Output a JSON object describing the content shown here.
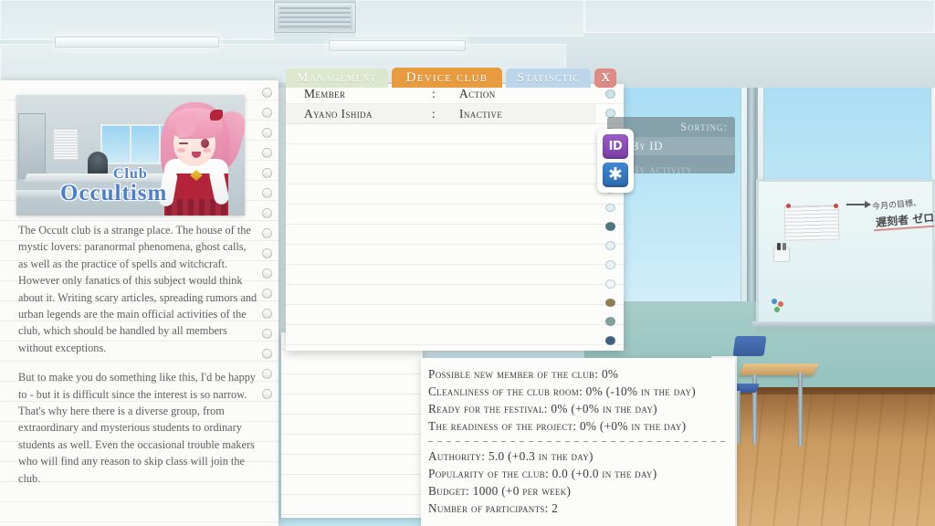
{
  "tabs": [
    {
      "label": "Management",
      "name": "tab-management",
      "state": "inactive"
    },
    {
      "label": "Device club",
      "name": "tab-device-club",
      "state": "active"
    },
    {
      "label": "Statisctic",
      "name": "tab-statistic",
      "state": "inactive"
    }
  ],
  "close_button": {
    "label": "X"
  },
  "member_table": {
    "headers": {
      "member": "Member",
      "separator": ":",
      "action": "Action"
    },
    "rows": [
      {
        "member": "Ayano Ishida",
        "separator": ":",
        "action": "Inactive"
      }
    ]
  },
  "sorting": {
    "title": "Sorting:",
    "options": [
      {
        "label": "By ID",
        "selected": true
      },
      {
        "label": "By activity",
        "selected": false
      }
    ],
    "buttons": [
      {
        "icon": "id-icon",
        "label": "ID",
        "color": "#8a4cb8"
      },
      {
        "icon": "asterisk-icon",
        "label": "✱",
        "color": "#3478c0"
      }
    ]
  },
  "club": {
    "title_small": "Club",
    "title_main": "Occultism",
    "description": [
      "The Occult club is a strange place. The house of the mystic lovers: paranormal phenomena, ghost calls, as well as the practice of spells and witchcraft. However only fanatics of this subject would think about it. Writing scary articles, spreading rumors and urban legends are the main official activities of the club, which should be handled by all members without exceptions.",
      "But to make you do something like this, I'd be happy to - but it is difficult since the interest is so narrow. That's why here there is a diverse group, from extraordinary and mysterious students to ordinary students as well. Even the occasional trouble makers who will find any reason to skip class will join the club."
    ]
  },
  "stats": {
    "group_one": [
      "Possible new member of the club: 0%",
      "Cleanliness of the club room: 0% (-10% in the day)",
      "Ready for the festival: 0% (+0% in the day)",
      "The readiness of the project: 0% (+0% in the day)"
    ],
    "group_two": [
      "Authority: 5.0 (+0.3 in the day)",
      "Popularity of the club: 0.0 (+0.0 in the day)",
      "Budget: 1000 (+0 per week)",
      "Number of participants: 2"
    ]
  },
  "whiteboard": {
    "note_line_1": "今月の目標、",
    "note_line_2": "遅刻者 ゼロ！！"
  },
  "colors": {
    "tab_active": "#e89b3f",
    "tab_management": "#dde7cd",
    "tab_statistic": "#bcd5e8",
    "close": "#e08a86",
    "title_blue": "#4a7fd0",
    "panel_bg": "#fcfcfb"
  },
  "panel_dots": [
    "#c9e4e8",
    "#cfe8ec",
    "#d8eef1",
    "#e6f3f4",
    "#eef7f8",
    "#e2f0f2",
    "#dff0f2",
    "#4f757f",
    "#e4f1f3",
    "#eaf4f5",
    "#f0f6f7",
    "#8f7c4a",
    "#7fa39c",
    "#3b5e7e"
  ],
  "swatches": [
    "#e6d6bd",
    "#2e4a46",
    "#9fc3bd",
    "#5a6b70",
    "#8a6236",
    "#a9844e",
    "#c9a469",
    "#d9bf8a",
    "#b9a279"
  ]
}
